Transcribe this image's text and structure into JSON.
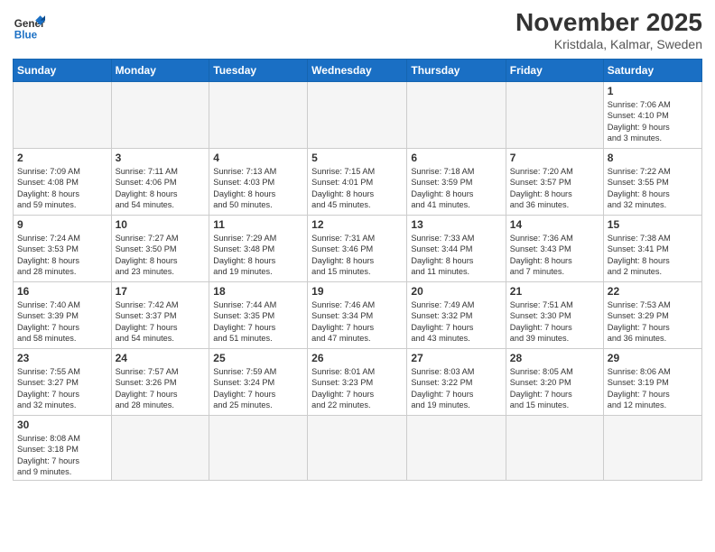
{
  "header": {
    "logo_general": "General",
    "logo_blue": "Blue",
    "month_title": "November 2025",
    "location": "Kristdala, Kalmar, Sweden"
  },
  "weekdays": [
    "Sunday",
    "Monday",
    "Tuesday",
    "Wednesday",
    "Thursday",
    "Friday",
    "Saturday"
  ],
  "weeks": [
    [
      {
        "day": "",
        "info": ""
      },
      {
        "day": "",
        "info": ""
      },
      {
        "day": "",
        "info": ""
      },
      {
        "day": "",
        "info": ""
      },
      {
        "day": "",
        "info": ""
      },
      {
        "day": "",
        "info": ""
      },
      {
        "day": "1",
        "info": "Sunrise: 7:06 AM\nSunset: 4:10 PM\nDaylight: 9 hours\nand 3 minutes."
      }
    ],
    [
      {
        "day": "2",
        "info": "Sunrise: 7:09 AM\nSunset: 4:08 PM\nDaylight: 8 hours\nand 59 minutes."
      },
      {
        "day": "3",
        "info": "Sunrise: 7:11 AM\nSunset: 4:06 PM\nDaylight: 8 hours\nand 54 minutes."
      },
      {
        "day": "4",
        "info": "Sunrise: 7:13 AM\nSunset: 4:03 PM\nDaylight: 8 hours\nand 50 minutes."
      },
      {
        "day": "5",
        "info": "Sunrise: 7:15 AM\nSunset: 4:01 PM\nDaylight: 8 hours\nand 45 minutes."
      },
      {
        "day": "6",
        "info": "Sunrise: 7:18 AM\nSunset: 3:59 PM\nDaylight: 8 hours\nand 41 minutes."
      },
      {
        "day": "7",
        "info": "Sunrise: 7:20 AM\nSunset: 3:57 PM\nDaylight: 8 hours\nand 36 minutes."
      },
      {
        "day": "8",
        "info": "Sunrise: 7:22 AM\nSunset: 3:55 PM\nDaylight: 8 hours\nand 32 minutes."
      }
    ],
    [
      {
        "day": "9",
        "info": "Sunrise: 7:24 AM\nSunset: 3:53 PM\nDaylight: 8 hours\nand 28 minutes."
      },
      {
        "day": "10",
        "info": "Sunrise: 7:27 AM\nSunset: 3:50 PM\nDaylight: 8 hours\nand 23 minutes."
      },
      {
        "day": "11",
        "info": "Sunrise: 7:29 AM\nSunset: 3:48 PM\nDaylight: 8 hours\nand 19 minutes."
      },
      {
        "day": "12",
        "info": "Sunrise: 7:31 AM\nSunset: 3:46 PM\nDaylight: 8 hours\nand 15 minutes."
      },
      {
        "day": "13",
        "info": "Sunrise: 7:33 AM\nSunset: 3:44 PM\nDaylight: 8 hours\nand 11 minutes."
      },
      {
        "day": "14",
        "info": "Sunrise: 7:36 AM\nSunset: 3:43 PM\nDaylight: 8 hours\nand 7 minutes."
      },
      {
        "day": "15",
        "info": "Sunrise: 7:38 AM\nSunset: 3:41 PM\nDaylight: 8 hours\nand 2 minutes."
      }
    ],
    [
      {
        "day": "16",
        "info": "Sunrise: 7:40 AM\nSunset: 3:39 PM\nDaylight: 7 hours\nand 58 minutes."
      },
      {
        "day": "17",
        "info": "Sunrise: 7:42 AM\nSunset: 3:37 PM\nDaylight: 7 hours\nand 54 minutes."
      },
      {
        "day": "18",
        "info": "Sunrise: 7:44 AM\nSunset: 3:35 PM\nDaylight: 7 hours\nand 51 minutes."
      },
      {
        "day": "19",
        "info": "Sunrise: 7:46 AM\nSunset: 3:34 PM\nDaylight: 7 hours\nand 47 minutes."
      },
      {
        "day": "20",
        "info": "Sunrise: 7:49 AM\nSunset: 3:32 PM\nDaylight: 7 hours\nand 43 minutes."
      },
      {
        "day": "21",
        "info": "Sunrise: 7:51 AM\nSunset: 3:30 PM\nDaylight: 7 hours\nand 39 minutes."
      },
      {
        "day": "22",
        "info": "Sunrise: 7:53 AM\nSunset: 3:29 PM\nDaylight: 7 hours\nand 36 minutes."
      }
    ],
    [
      {
        "day": "23",
        "info": "Sunrise: 7:55 AM\nSunset: 3:27 PM\nDaylight: 7 hours\nand 32 minutes."
      },
      {
        "day": "24",
        "info": "Sunrise: 7:57 AM\nSunset: 3:26 PM\nDaylight: 7 hours\nand 28 minutes."
      },
      {
        "day": "25",
        "info": "Sunrise: 7:59 AM\nSunset: 3:24 PM\nDaylight: 7 hours\nand 25 minutes."
      },
      {
        "day": "26",
        "info": "Sunrise: 8:01 AM\nSunset: 3:23 PM\nDaylight: 7 hours\nand 22 minutes."
      },
      {
        "day": "27",
        "info": "Sunrise: 8:03 AM\nSunset: 3:22 PM\nDaylight: 7 hours\nand 19 minutes."
      },
      {
        "day": "28",
        "info": "Sunrise: 8:05 AM\nSunset: 3:20 PM\nDaylight: 7 hours\nand 15 minutes."
      },
      {
        "day": "29",
        "info": "Sunrise: 8:06 AM\nSunset: 3:19 PM\nDaylight: 7 hours\nand 12 minutes."
      }
    ],
    [
      {
        "day": "30",
        "info": "Sunrise: 8:08 AM\nSunset: 3:18 PM\nDaylight: 7 hours\nand 9 minutes."
      },
      {
        "day": "",
        "info": ""
      },
      {
        "day": "",
        "info": ""
      },
      {
        "day": "",
        "info": ""
      },
      {
        "day": "",
        "info": ""
      },
      {
        "day": "",
        "info": ""
      },
      {
        "day": "",
        "info": ""
      }
    ]
  ]
}
